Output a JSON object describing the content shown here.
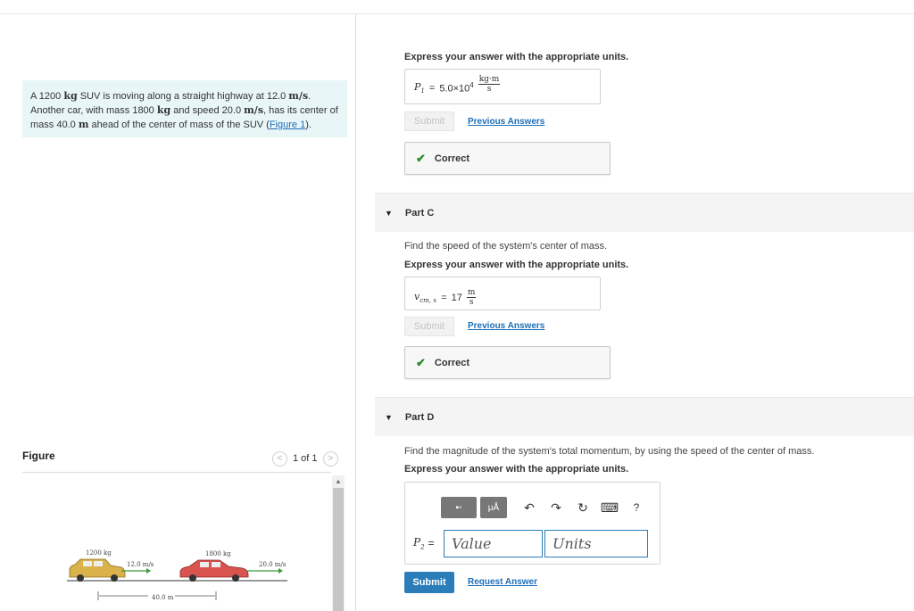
{
  "problem": {
    "text_pre": "A 1200 ",
    "u_kg1": "kg",
    "text_1": " SUV is moving along a straight highway at 12.0 ",
    "u_ms1": "m/s",
    "text_2": ". Another car, with mass 1800 ",
    "u_kg2": "kg",
    "text_3": " and speed 20.0 ",
    "u_ms2": "m/s",
    "text_4": ", has its center of mass 40.0 ",
    "u_m": "m",
    "text_5": " ahead of the center of mass of the SUV (",
    "figure_link": "Figure 1",
    "text_6": ")."
  },
  "figure": {
    "title": "Figure",
    "prev_icon": "<",
    "next_icon": ">",
    "count": "1 of 1",
    "scroll_up": "▲",
    "suv_mass": "1200 kg",
    "suv_speed": "12.0 m/s",
    "car_mass": "1800 kg",
    "car_speed": "20.0 m/s",
    "distance": "40.0 m",
    "suv_color": "#d9b24a",
    "car_color": "#d9534f"
  },
  "partB": {
    "express": "Express your answer with the appropriate units.",
    "var": "P",
    "var_sub": "1",
    "equals": "=",
    "value": "5.0×10",
    "exp": "4",
    "unit_num": "kg·m",
    "unit_den": "s",
    "submit": "Submit",
    "previous": "Previous Answers",
    "check": "✔",
    "correct": "Correct"
  },
  "partC": {
    "tri": "▼",
    "title": "Part C",
    "prompt": "Find the speed of the system's center of mass.",
    "express": "Express your answer with the appropriate units.",
    "var": "v",
    "var_sub": "cm, x",
    "equals": "=",
    "value": "17",
    "unit_num": "m",
    "unit_den": "s",
    "submit": "Submit",
    "previous": "Previous Answers",
    "check": "✔",
    "correct": "Correct"
  },
  "partD": {
    "tri": "▼",
    "title": "Part D",
    "prompt": "Find the magnitude of the system's total momentum, by using the speed of the center of mass.",
    "express": "Express your answer with the appropriate units.",
    "tb_templates": "▪▫",
    "tb_units": "μÅ",
    "undo": "↶",
    "redo": "↷",
    "reset": "↻",
    "keyboard": "⌨",
    "help": "?",
    "var": "P",
    "var_sub": "2",
    "equals": "=",
    "value_placeholder": "Value",
    "units_placeholder": "Units",
    "submit": "Submit",
    "request": "Request Answer"
  }
}
